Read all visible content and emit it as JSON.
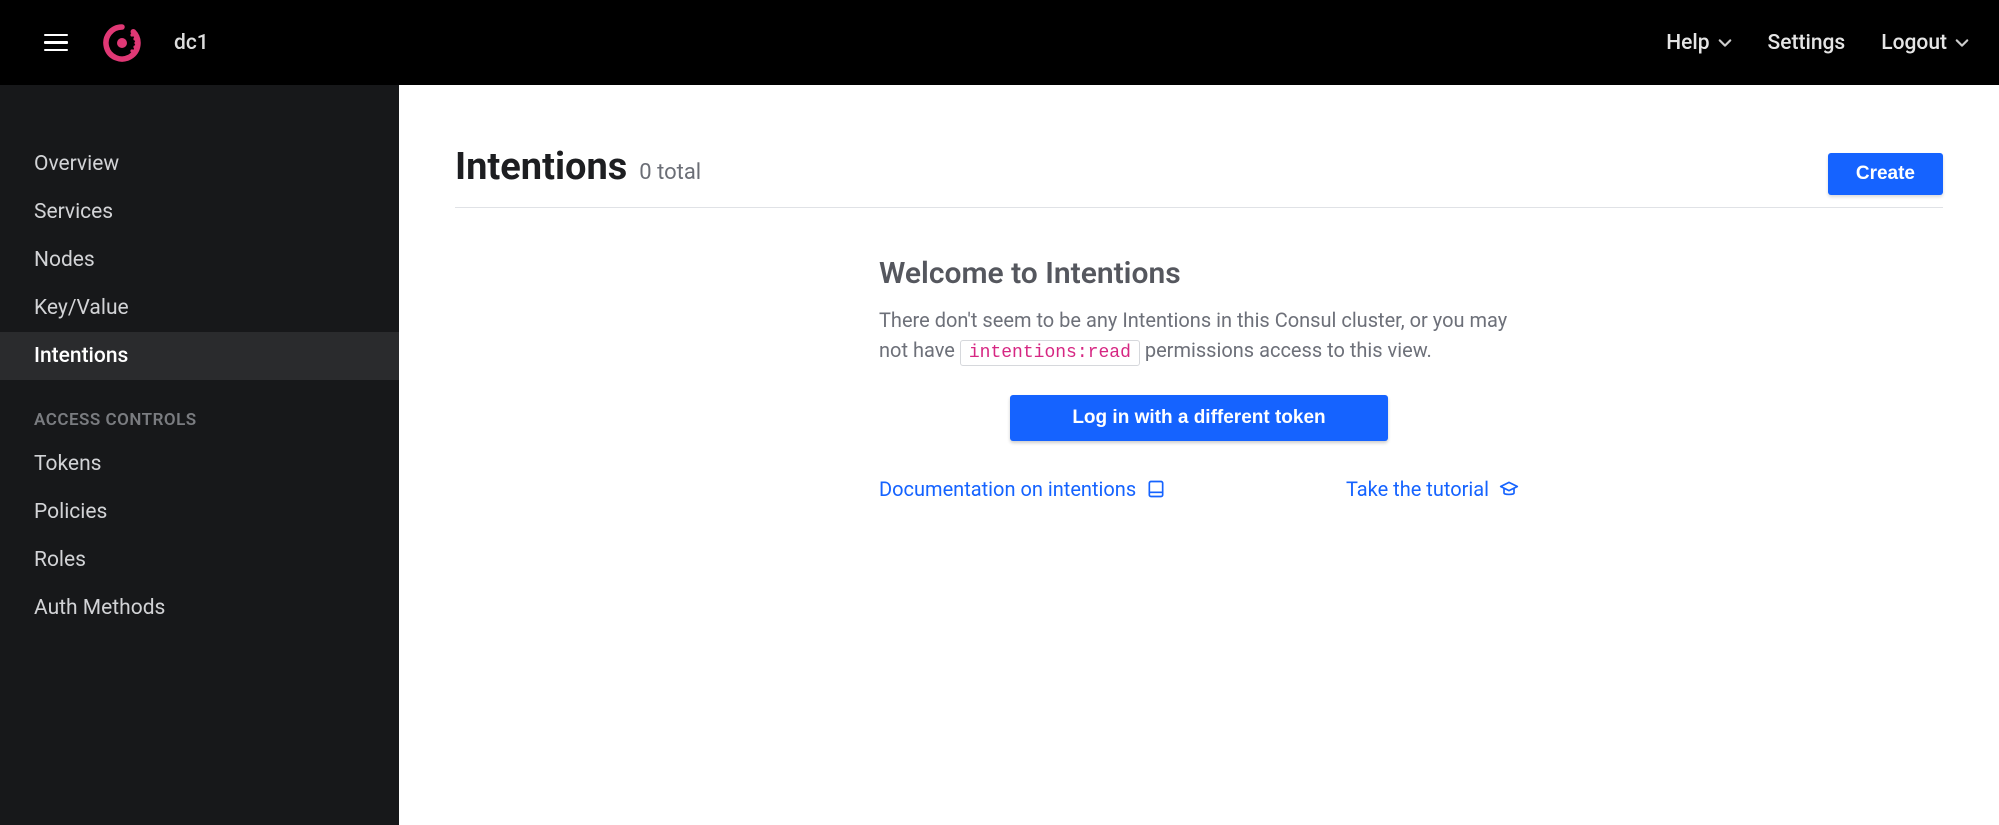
{
  "header": {
    "datacenter": "dc1",
    "help_label": "Help",
    "settings_label": "Settings",
    "logout_label": "Logout"
  },
  "sidebar": {
    "items": [
      {
        "label": "Overview",
        "active": false
      },
      {
        "label": "Services",
        "active": false
      },
      {
        "label": "Nodes",
        "active": false
      },
      {
        "label": "Key/Value",
        "active": false
      },
      {
        "label": "Intentions",
        "active": true
      }
    ],
    "section_header": "ACCESS CONTROLS",
    "access_items": [
      {
        "label": "Tokens"
      },
      {
        "label": "Policies"
      },
      {
        "label": "Roles"
      },
      {
        "label": "Auth Methods"
      }
    ]
  },
  "page": {
    "title": "Intentions",
    "subtitle": "0 total",
    "create_label": "Create"
  },
  "empty": {
    "title": "Welcome to Intentions",
    "text_before": "There don't seem to be any Intentions in this Consul cluster, or you may not have ",
    "permission_code": "intentions:read",
    "text_after": " permissions access to this view.",
    "login_button": "Log in with a different token",
    "doc_link": "Documentation on intentions",
    "tutorial_link": "Take the tutorial"
  }
}
